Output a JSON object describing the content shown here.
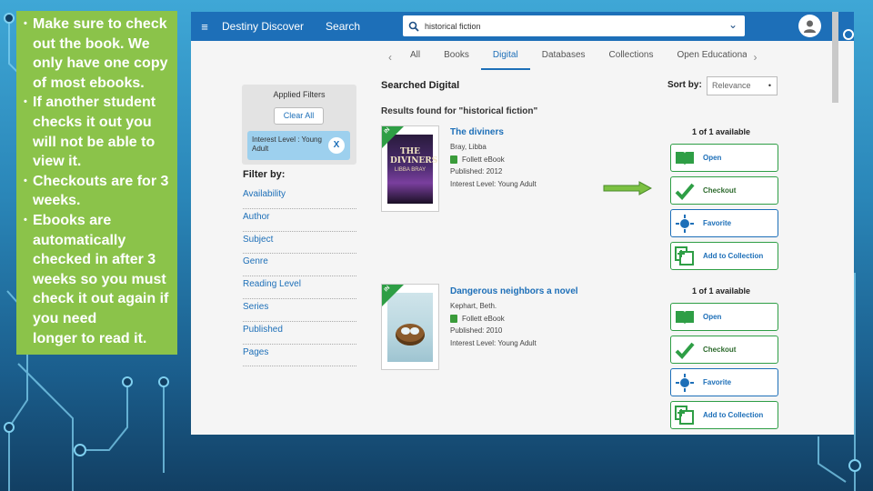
{
  "callout": {
    "bullets": [
      "Make sure to check out the book.  We only have one copy of most ebooks.",
      "If another student checks it out you will not be able to view it.",
      "Checkouts are for 3 weeks.",
      "Ebooks are automatically checked in after 3 weeks so you must check it out again if you need"
    ],
    "overflow_text": "longer to read it."
  },
  "app": {
    "brand": "Destiny Discover",
    "search_label": "Search",
    "search_value": "historical fiction",
    "tabs": [
      "All",
      "Books",
      "Digital",
      "Databases",
      "Collections",
      "Open Educational R"
    ],
    "active_tab": "Digital",
    "searched_heading": "Searched Digital",
    "results_for": "Results found for \"historical fiction\"",
    "sort_label": "Sort by:",
    "sort_value": "Relevance",
    "applied_filters": {
      "title": "Applied Filters",
      "clear_label": "Clear All",
      "chip_label": "Interest Level : Young Adult",
      "chip_remove": "X"
    },
    "filter_by": "Filter by:",
    "filters": [
      "Availability",
      "Author",
      "Subject",
      "Genre",
      "Reading Level",
      "Series",
      "Published",
      "Pages"
    ],
    "results": [
      {
        "title": "The diviners",
        "author": "Bray, Libba",
        "format": "Follett eBook",
        "published": "Published: 2012",
        "interest": "Interest Level: Young Adult",
        "availability": "1 of 1 available",
        "cover_title": "THE DIVINERS",
        "cover_author": "LIBBA BRAY",
        "ribbon": "IN",
        "actions": [
          "Open",
          "Checkout",
          "Favorite",
          "Add to Collection"
        ]
      },
      {
        "title": "Dangerous neighbors a novel",
        "author": "Kephart, Beth.",
        "format": "Follett eBook",
        "published": "Published: 2010",
        "interest": "Interest Level: Young Adult",
        "availability": "1 of 1 available",
        "ribbon": "IN",
        "actions": [
          "Open",
          "Checkout",
          "Favorite",
          "Add to Collection"
        ]
      }
    ]
  },
  "colors": {
    "topbar": "#1d6fb8",
    "callout": "#8bc34a",
    "accent_green": "#2e9e45",
    "link_blue": "#1d6fb8"
  }
}
